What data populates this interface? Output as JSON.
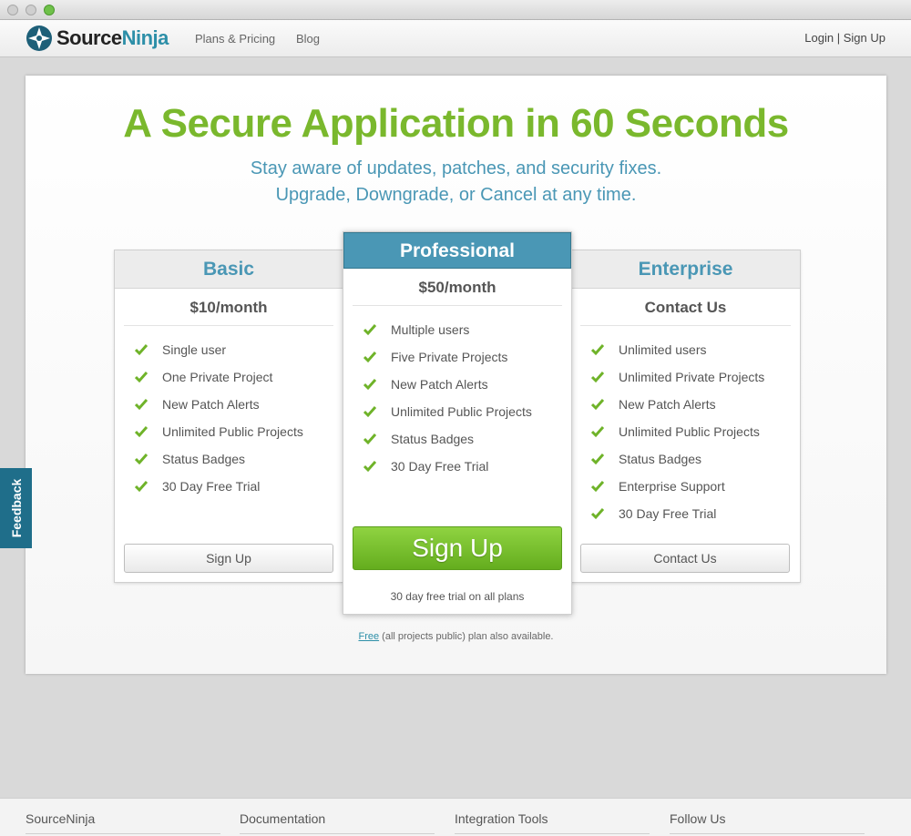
{
  "nav": {
    "logo_part1": "Source",
    "logo_part2": "Ninja",
    "links": [
      "Plans & Pricing",
      "Blog"
    ],
    "login": "Login",
    "separator": "|",
    "signup": "Sign Up"
  },
  "hero": {
    "headline": "A Secure Application in 60 Seconds",
    "subline1": "Stay aware of updates, patches, and security fixes.",
    "subline2": "Upgrade, Downgrade, or Cancel at any time."
  },
  "plans": {
    "basic": {
      "name": "Basic",
      "price": "$10/month",
      "features": [
        "Single user",
        "One Private Project",
        "New Patch Alerts",
        "Unlimited Public Projects",
        "Status Badges",
        "30 Day Free Trial"
      ],
      "button": "Sign Up"
    },
    "professional": {
      "name": "Professional",
      "price": "$50/month",
      "features": [
        "Multiple users",
        "Five Private Projects",
        "New Patch Alerts",
        "Unlimited Public Projects",
        "Status Badges",
        "30 Day Free Trial"
      ],
      "button": "Sign Up",
      "note": "30 day free trial on all plans"
    },
    "enterprise": {
      "name": "Enterprise",
      "price": "Contact Us",
      "features": [
        "Unlimited users",
        "Unlimited Private Projects",
        "New Patch Alerts",
        "Unlimited Public Projects",
        "Status Badges",
        "Enterprise Support",
        "30 Day Free Trial"
      ],
      "button": "Contact Us"
    }
  },
  "free_note": {
    "link": "Free",
    "text": " (all projects public) plan also available."
  },
  "feedback": "Feedback",
  "footer": [
    "SourceNinja",
    "Documentation",
    "Integration Tools",
    "Follow Us"
  ],
  "colors": {
    "accent_green": "#7ab82d",
    "accent_blue": "#4a97b5",
    "feedback_tab": "#1f6e8a"
  },
  "icons": {
    "feature": "check-icon",
    "logo": "ninja-star-icon"
  }
}
